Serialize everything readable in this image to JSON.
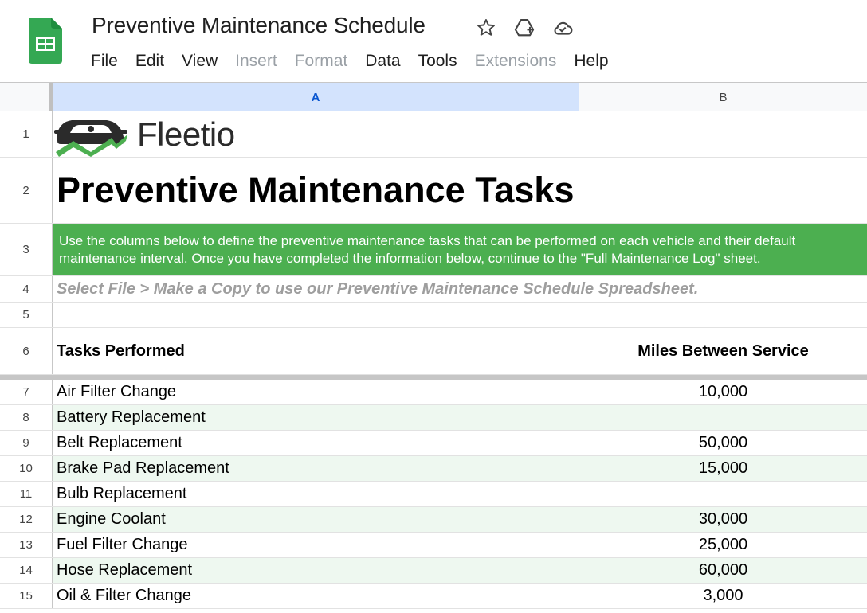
{
  "document": {
    "title": "Preventive Maintenance Schedule"
  },
  "menu": [
    "File",
    "Edit",
    "View",
    "Insert",
    "Format",
    "Data",
    "Tools",
    "Extensions",
    "Help"
  ],
  "menu_disabled": [
    "Insert",
    "Format",
    "Extensions"
  ],
  "icons": [
    "sheets-app-icon",
    "star-icon",
    "move-to-drive-icon",
    "cloud-saved-icon"
  ],
  "columns": [
    "A",
    "B"
  ],
  "sheet": {
    "logo_text": "Fleetio",
    "heading": "Preventive Maintenance Tasks",
    "banner": "Use the columns below to define the preventive maintenance tasks that can be performed on each vehicle and their default maintenance interval. Once you have completed the information below, continue to the \"Full Maintenance Log\" sheet.",
    "hint": "Select File > Make a Copy to use our Preventive Maintenance Schedule Spreadsheet.",
    "table_headers": [
      "Tasks Performed",
      "Miles Between Service"
    ]
  },
  "row_numbers": [
    "1",
    "2",
    "3",
    "4",
    "5",
    "6",
    "7",
    "8",
    "9",
    "10",
    "11",
    "12",
    "13",
    "14",
    "15"
  ],
  "tasks": [
    {
      "task": "Air Filter Change",
      "miles": "10,000"
    },
    {
      "task": "Battery Replacement",
      "miles": ""
    },
    {
      "task": "Belt Replacement",
      "miles": "50,000"
    },
    {
      "task": "Brake Pad Replacement",
      "miles": "15,000"
    },
    {
      "task": "Bulb Replacement",
      "miles": ""
    },
    {
      "task": "Engine Coolant",
      "miles": "30,000"
    },
    {
      "task": "Fuel Filter Change",
      "miles": "25,000"
    },
    {
      "task": "Hose Replacement",
      "miles": "60,000"
    },
    {
      "task": "Oil & Filter Change",
      "miles": "3,000"
    }
  ],
  "colors": {
    "banner_green": "#4caf50",
    "band_green": "#eef8f0",
    "selected_column": "#d3e3fd",
    "sheets_green": "#34a853"
  }
}
